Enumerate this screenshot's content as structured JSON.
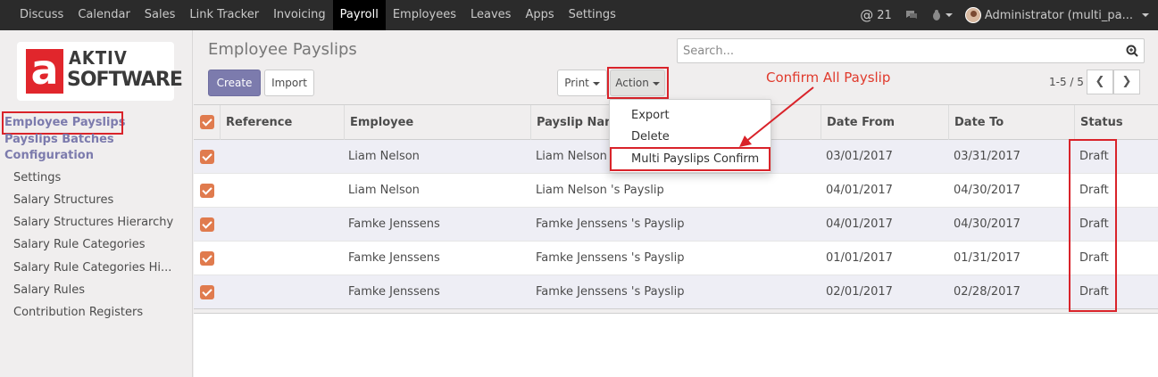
{
  "navbar": {
    "menu": [
      "Discuss",
      "Calendar",
      "Sales",
      "Link Tracker",
      "Invoicing",
      "Payroll",
      "Employees",
      "Leaves",
      "Apps",
      "Settings"
    ],
    "active": "Payroll",
    "notification_count": "21",
    "user_label": "Administrator (multi_pa..."
  },
  "logo": {
    "letter": "a",
    "line1": "AKTIV",
    "line2": "SOFTWARE"
  },
  "sidebar": {
    "sections": [
      "Employee Payslips",
      "Payslips Batches",
      "Configuration"
    ],
    "items": [
      "Settings",
      "Salary Structures",
      "Salary Structures Hierarchy",
      "Salary Rule Categories",
      "Salary Rule Categories Hi...",
      "Salary Rules",
      "Contribution Registers"
    ]
  },
  "page": {
    "title": "Employee Payslips",
    "create_label": "Create",
    "import_label": "Import",
    "print_label": "Print",
    "action_label": "Action",
    "search_placeholder": "Search...",
    "pager": "1-5 / 5"
  },
  "table": {
    "columns": [
      "Reference",
      "Employee",
      "Payslip Name",
      "Date From",
      "Date To",
      "Status"
    ],
    "rows": [
      {
        "employee": "Liam Nelson",
        "payslip": "Liam Nelson 's Payslip",
        "date_from": "03/01/2017",
        "date_to": "03/31/2017",
        "status": "Draft"
      },
      {
        "employee": "Liam Nelson",
        "payslip": "Liam Nelson 's Payslip",
        "date_from": "04/01/2017",
        "date_to": "04/30/2017",
        "status": "Draft"
      },
      {
        "employee": "Famke Jenssens",
        "payslip": "Famke Jenssens 's Payslip",
        "date_from": "04/01/2017",
        "date_to": "04/30/2017",
        "status": "Draft"
      },
      {
        "employee": "Famke Jenssens",
        "payslip": "Famke Jenssens 's Payslip",
        "date_from": "01/01/2017",
        "date_to": "01/31/2017",
        "status": "Draft"
      },
      {
        "employee": "Famke Jenssens",
        "payslip": "Famke Jenssens 's Payslip",
        "date_from": "02/01/2017",
        "date_to": "02/28/2017",
        "status": "Draft"
      }
    ]
  },
  "action_menu": {
    "items": [
      "Export",
      "Delete",
      "Multi Payslips Confirm"
    ]
  },
  "annotation": "Confirm All Payslip",
  "colors": {
    "brand": "#7c7bad",
    "checkbox": "#e07b4e",
    "highlight": "#d9232a"
  }
}
